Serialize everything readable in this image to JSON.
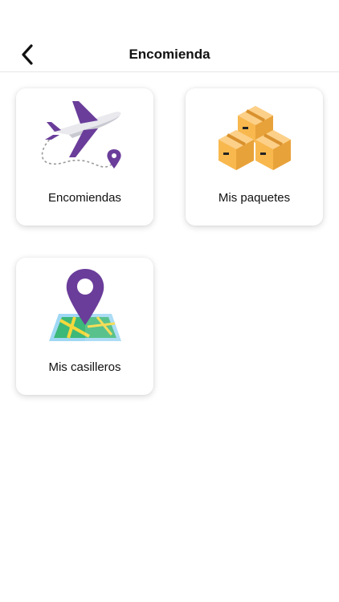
{
  "header": {
    "title": "Encomienda",
    "back_icon": "chevron-left-icon"
  },
  "menu": {
    "items": [
      {
        "label": "Encomiendas",
        "icon": "airplane-route-icon"
      },
      {
        "label": "Mis paquetes",
        "icon": "boxes-icon"
      },
      {
        "label": "Mis casilleros",
        "icon": "map-pin-icon"
      }
    ]
  },
  "colors": {
    "accent_purple": "#6a3d9a",
    "box_orange": "#f8b84e",
    "map_green": "#3cb878",
    "map_blue": "#9fd8f4"
  }
}
